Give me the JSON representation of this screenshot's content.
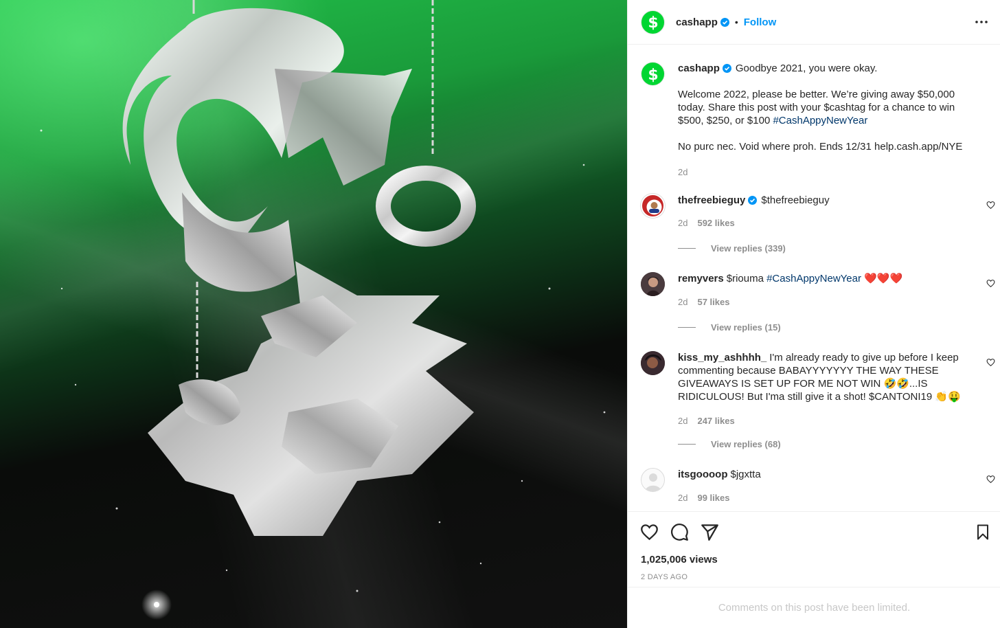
{
  "post": {
    "author": "cashapp",
    "follow_label": "Follow",
    "separator": "•"
  },
  "caption": {
    "username": "cashapp",
    "line1": "Goodbye 2021, you were okay.",
    "line2_prefix": "Welcome 2022, please be better. We’re giving away $50,000 today. Share this post with your $cashtag for a chance to win $500, $250, or $100 ",
    "hashtag": "#CashAppyNewYear",
    "line3": "No purc nec. Void where proh. Ends 12/31 help.cash.app/NYE",
    "time": "2d"
  },
  "comments": [
    {
      "username": "thefreebieguy",
      "verified": true,
      "text": "$thefreebieguy",
      "time": "2d",
      "likes": "592 likes",
      "replies": "View replies (339)"
    },
    {
      "username": "remyvers",
      "text_prefix": "$riouma ",
      "hashtag": "#CashAppyNewYear",
      "emoji": "❤️❤️❤️",
      "time": "2d",
      "likes": "57 likes",
      "replies": "View replies (15)"
    },
    {
      "username": "kiss_my_ashhhh_",
      "text": "I'm already ready to give up before I keep commenting because BABAYYYYYYY THE WAY THESE GIVEAWAYS IS SET UP FOR ME NOT WIN 🤣🤣...IS RIDICULOUS! But I'ma still give it a shot! $CANTONI19 👏🤑",
      "time": "2d",
      "likes": "247 likes",
      "replies": "View replies (68)"
    },
    {
      "username": "itsgoooop",
      "text": "$jgxtta",
      "time": "2d",
      "likes": "99 likes"
    }
  ],
  "stats": {
    "views": "1,025,006 views",
    "date": "2 DAYS AGO"
  },
  "footer": {
    "limited": "Comments on this post have been limited."
  },
  "icons": {
    "brand_color": "#00d632",
    "verified_color": "#0095f6",
    "link_color": "#00376b"
  }
}
